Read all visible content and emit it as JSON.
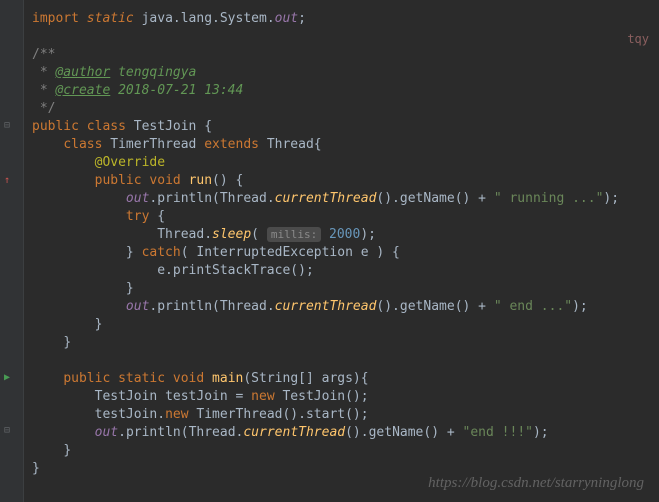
{
  "reviewer": "tqy",
  "code": {
    "import": {
      "kw1": "import",
      "kw2": "static",
      "path": "java.lang.System.",
      "field": "out",
      "semi": ";"
    },
    "doc": {
      "open": "/**",
      "author_tag": "@author",
      "author_val": "tengqingya",
      "create_tag": "@create",
      "create_val": "2018-07-21 13:44",
      "close": " */"
    },
    "outer": {
      "public": "public",
      "class_kw": "class",
      "name": "TestJoin",
      "brace": " {"
    },
    "inner": {
      "class_kw": "class",
      "name": "TimerThread",
      "extends": "extends",
      "parent": "Thread",
      "brace": "{"
    },
    "override": "@Override",
    "run": {
      "public": "public",
      "void": "void",
      "name": "run",
      "sig": "() {"
    },
    "println1": {
      "out": "out",
      "dot1": ".",
      "println": "println",
      "open": "(",
      "thread": "Thread",
      "dot2": ".",
      "current": "currentThread",
      "paren": "().",
      "getname": "getName",
      "paren2": "() + ",
      "str": "\" running ...\"",
      "close": ");"
    },
    "try": {
      "kw": "try",
      "brace": " {"
    },
    "sleep": {
      "thread": "Thread",
      "dot": ".",
      "sleep": "sleep",
      "open": "( ",
      "hint": "millis:",
      "val": "2000",
      "close": ");"
    },
    "catch": {
      "close_try": "}",
      "catch": "catch",
      "open": "( ",
      "exc": "InterruptedException",
      "var": " e ) {"
    },
    "printstack": {
      "e": "e.",
      "method": "printStackTrace",
      "close": "();"
    },
    "close_catch": "}",
    "println2": {
      "out": "out",
      "dot1": ".",
      "println": "println",
      "open": "(",
      "thread": "Thread",
      "dot2": ".",
      "current": "currentThread",
      "paren": "().",
      "getname": "getName",
      "paren2": "() + ",
      "str": "\" end ...\"",
      "close": ");"
    },
    "close_run": "}",
    "close_inner": "}",
    "main": {
      "public": "public",
      "static": "static",
      "void": "void",
      "name": "main",
      "sig": "(String[] args){"
    },
    "line1": {
      "type": "TestJoin",
      "var": " testJoin = ",
      "new": "new",
      "call": " TestJoin();"
    },
    "line2": {
      "obj": "testJoin.",
      "new": "new",
      "call": " TimerThread().",
      "method": "start",
      "close": "();"
    },
    "println3": {
      "out": "out",
      "dot1": ".",
      "println": "println",
      "open": "(",
      "thread": "Thread",
      "dot2": ".",
      "current": "currentThread",
      "paren": "().",
      "getname": "getName",
      "paren2": "() + ",
      "str": "\"end !!!\"",
      "close": ");"
    },
    "close_main": "}",
    "close_outer": "}"
  },
  "watermark": "https://blog.csdn.net/starryninglong"
}
